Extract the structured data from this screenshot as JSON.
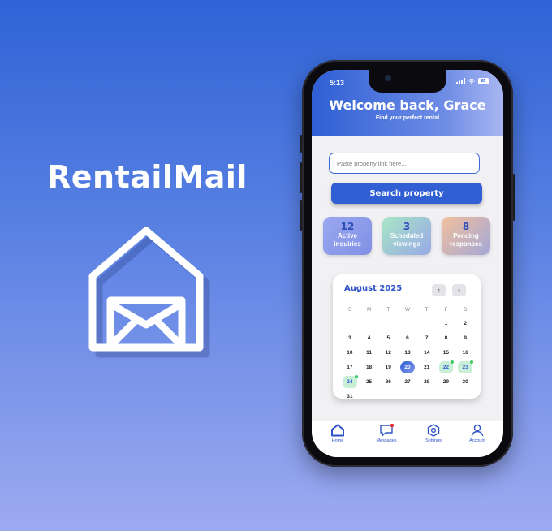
{
  "brand": {
    "name": "RentailMail",
    "logo_icon": "house-envelope-icon"
  },
  "status_bar": {
    "time": "5:13",
    "battery": "85"
  },
  "header": {
    "title": "Welcome back, Grace",
    "subtitle": "Find your perfect rental"
  },
  "search": {
    "placeholder": "Paste property link here...",
    "value": "",
    "button_label": "Search property"
  },
  "stats": [
    {
      "value": "12",
      "label": "Active inquiries",
      "color": "#8a99ea"
    },
    {
      "value": "3",
      "label": "Scheduled viewings",
      "color": "#a8e6c6"
    },
    {
      "value": "8",
      "label": "Pending responses",
      "color": "#f2bf9c"
    }
  ],
  "calendar": {
    "month_label": "August 2025",
    "weekdays": [
      "S",
      "M",
      "T",
      "W",
      "T",
      "F",
      "S"
    ],
    "leading_blanks": 5,
    "days": [
      "1",
      "2",
      "3",
      "4",
      "5",
      "6",
      "7",
      "8",
      "9",
      "10",
      "11",
      "12",
      "13",
      "14",
      "15",
      "16",
      "17",
      "18",
      "19",
      "20",
      "21",
      "22",
      "23",
      "24",
      "25",
      "26",
      "27",
      "28",
      "29",
      "30",
      "31"
    ],
    "today": "20",
    "viewing_days": [
      "22",
      "23",
      "24"
    ]
  },
  "tabs": [
    {
      "label": "Home",
      "icon": "home-icon",
      "badge": false
    },
    {
      "label": "Messages",
      "icon": "message-icon",
      "badge": true
    },
    {
      "label": "Settings",
      "icon": "settings-icon",
      "badge": false
    },
    {
      "label": "Account",
      "icon": "account-icon",
      "badge": false
    }
  ],
  "colors": {
    "accent": "#2f5fd3",
    "background_top": "#2f63d6",
    "background_bottom": "#9eaaf0",
    "badge": "#e5333f",
    "viewing": "#3ecb6a"
  }
}
